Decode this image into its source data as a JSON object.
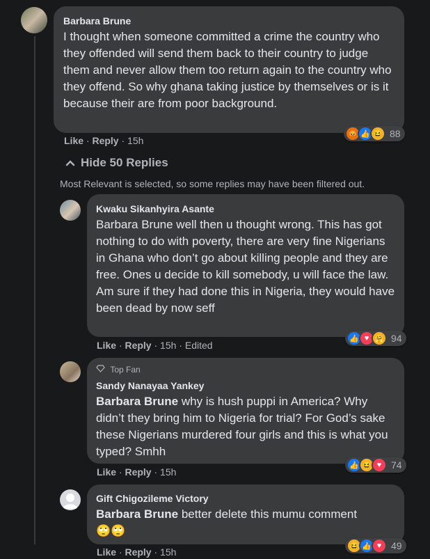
{
  "c1": {
    "author": "Barbara Brune",
    "text": "I thought when someone committed a crime the country who they offended will send them back to their country to judge them and never allow them too return again to the country who they offend. So why ghana taking justice by themselves or is it because their are from poor background.",
    "like": "Like",
    "reply": "Reply",
    "time": "15h",
    "react_count": "88"
  },
  "hide_replies": "Hide 50 Replies",
  "filter_note": "Most Relevant is selected, so some replies may have been filtered out.",
  "r1": {
    "author": "Kwaku Sikanhyira Asante",
    "text": "Barbara Brune well then u thought wrong. This has got nothing to do with poverty, there are very fine Nigerians in Ghana who don’t go about killing people and they are free. Ones u decide to kill somebody, u will face the law. Am sure if they had done this in Nigeria, they would have been dead by now seff",
    "like": "Like",
    "reply": "Reply",
    "time": "15h",
    "edited": "Edited",
    "react_count": "94"
  },
  "r2": {
    "badge": "Top Fan",
    "author": "Sandy Nanayaa Yankey",
    "mention": "Barbara Brune",
    "text": " why is hush puppi in America? Why didn’t they bring him to Nigeria for trial? For God’s sake these Nigerians murdered four girls and this is what you typed? Smhh",
    "like": "Like",
    "reply": "Reply",
    "time": "15h",
    "react_count": "74"
  },
  "r3": {
    "author": "Gift Chigozileme Victory",
    "mention": "Barbara Brune",
    "text": " better delete this mumu comment",
    "emojis": "🙄🙄",
    "like": "Like",
    "reply": "Reply",
    "time": "15h",
    "react_count": "49"
  }
}
